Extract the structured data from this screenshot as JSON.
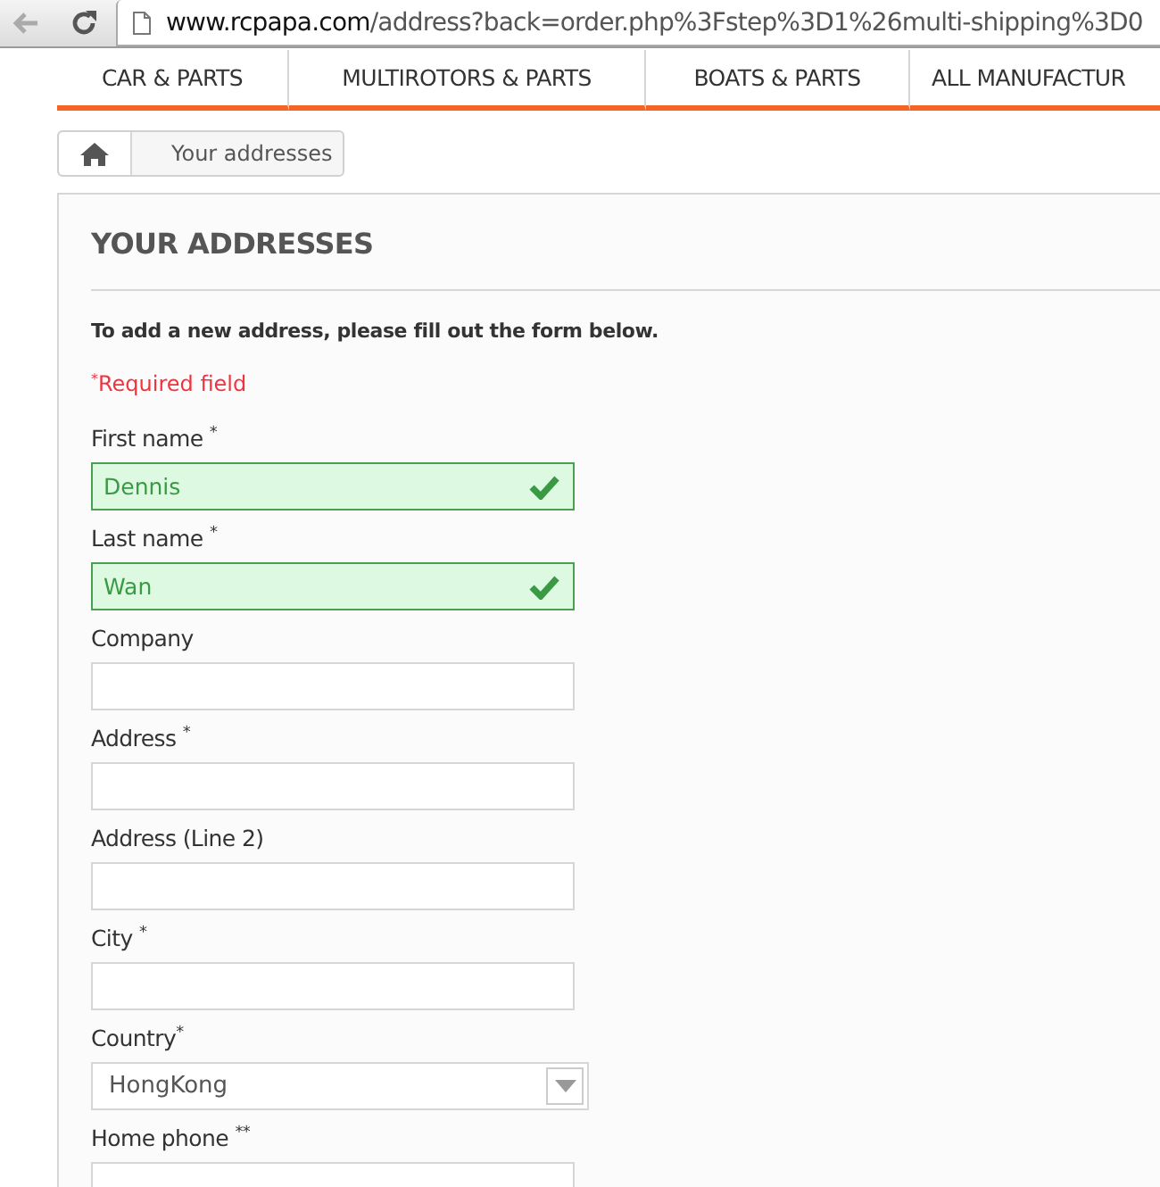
{
  "browser": {
    "url_host": "www.rcpapa.com",
    "url_path": "/address?back=order.php%3Fstep%3D1%26multi-shipping%3D0"
  },
  "nav": [
    "CAR & PARTS",
    "MULTIROTORS & PARTS",
    "BOATS & PARTS",
    "ALL MANUFACTUR"
  ],
  "breadcrumb": {
    "current": "Your addresses"
  },
  "panel": {
    "title": "YOUR ADDRESSES",
    "intro": "To add a new address, please fill out the form below.",
    "required_note": "$^{*}$Required field",
    "fields": [
      {
        "kind": "text",
        "label": "First name $^{*}$",
        "value": "Dennis",
        "valid": true
      },
      {
        "kind": "text",
        "label": "Last name $^{*}$",
        "value": "Wan",
        "valid": true
      },
      {
        "kind": "text",
        "label": "Company",
        "valid": false
      },
      {
        "kind": "text",
        "label": "Address $^{*}$",
        "valid": false
      },
      {
        "kind": "text",
        "label": "Address (Line 2)",
        "valid": false
      },
      {
        "kind": "text",
        "label": "City $^{*}$",
        "valid": false
      },
      {
        "kind": "select",
        "label": "Country$^{*}$",
        "value": "HongKong",
        "valid": false
      },
      {
        "kind": "text",
        "label": "Home phone $^{**}$",
        "valid": false
      }
    ]
  }
}
